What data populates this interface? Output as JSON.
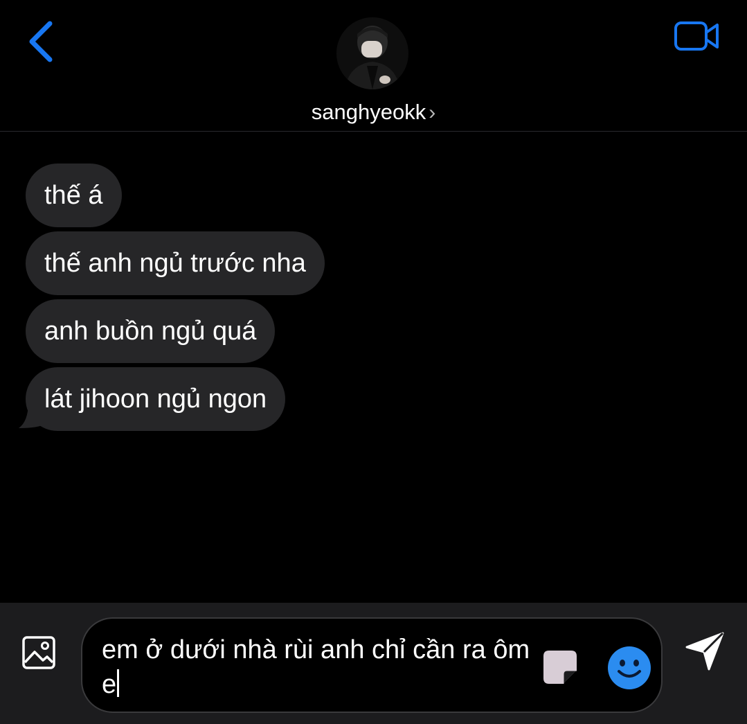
{
  "header": {
    "username": "sanghyeokk",
    "back_icon": "chevron-left-icon",
    "video_icon": "video-camera-icon",
    "accent_color": "#1877f2"
  },
  "messages": [
    {
      "text": "thế á"
    },
    {
      "text": "thế anh ngủ trước nha"
    },
    {
      "text": "anh buồn ngủ quá"
    },
    {
      "text": "lát jihoon ngủ ngon"
    }
  ],
  "composer": {
    "value": "em ở dưới nhà rùi anh chỉ cần ra ôm e",
    "gallery_icon": "image-icon",
    "sticker_icon": "sticker-icon",
    "emoji_icon": "smiley-icon",
    "send_icon": "send-icon"
  },
  "colors": {
    "background": "#000000",
    "bubble": "#262628",
    "composer_bar": "#1c1c1e",
    "accent": "#1877f2"
  }
}
